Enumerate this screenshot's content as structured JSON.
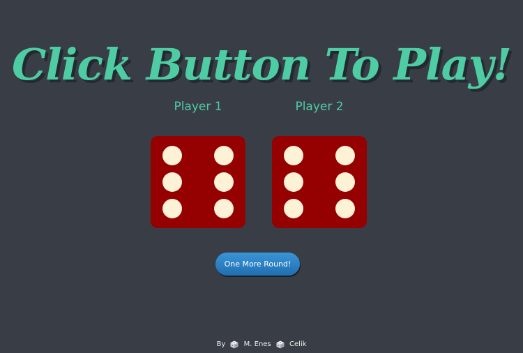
{
  "header": {
    "title": "Click Button To Play!"
  },
  "players": [
    {
      "label": "Player 1",
      "die_value": 6,
      "die_color": "#950101",
      "pip_color": "#fdf1d6"
    },
    {
      "label": "Player 2",
      "die_value": 6,
      "die_color": "#950101",
      "pip_color": "#fdf1d6"
    }
  ],
  "controls": {
    "play_button_label": "One More Round!"
  },
  "footer": {
    "prefix": "By",
    "first_name": "M. Enes",
    "last_name": "Celik",
    "icon": "dice-cube-icon"
  },
  "colors": {
    "background": "#393e46",
    "accent": "#4ecca3",
    "button": "#2a80c4"
  }
}
